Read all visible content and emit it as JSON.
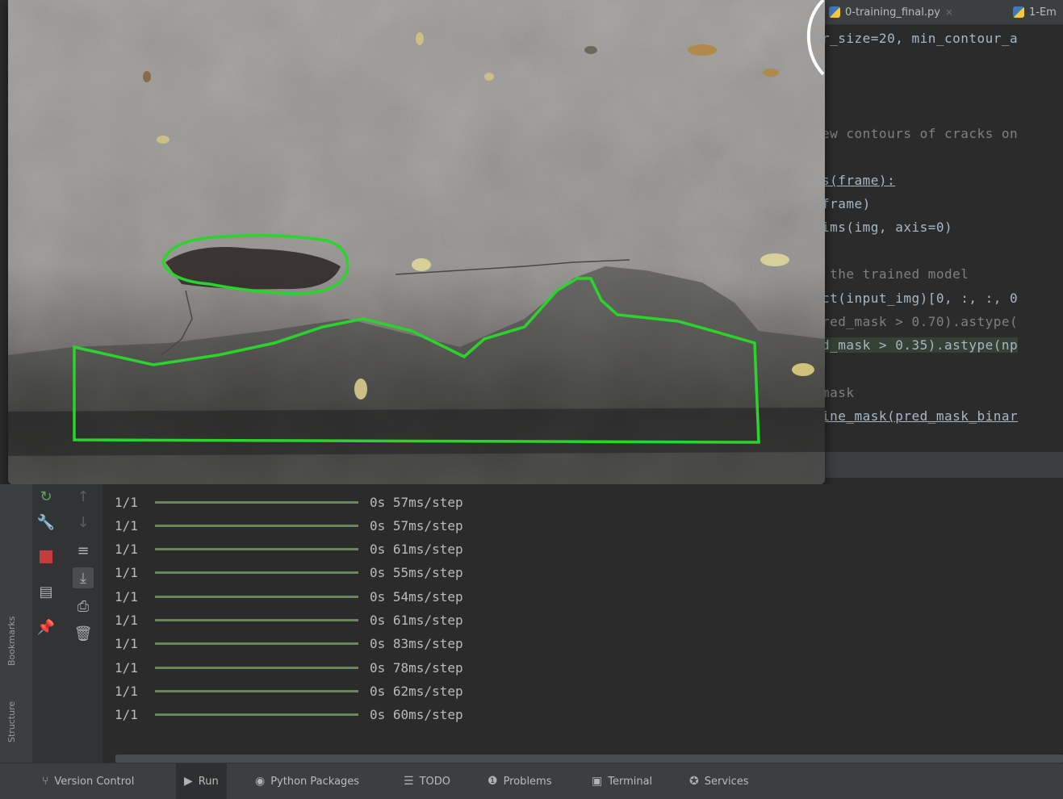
{
  "editor": {
    "tabs": [
      {
        "label": "0-training_final.py",
        "close": "×"
      },
      {
        "label": "1-Em",
        "close": ""
      }
    ],
    "code_lines": [
      {
        "text": "r_size=20, min_contour_a"
      },
      {
        "text": "ew contours of cracks on"
      },
      {
        "text": "s(frame):"
      },
      {
        "text": "frame)"
      },
      {
        "text": "ims(img, axis=0)"
      },
      {
        "text": " the trained model"
      },
      {
        "text": "ct(input_img)[0, :, :, 0"
      },
      {
        "text": "red_mask > 0.70).astype("
      },
      {
        "text": "d_mask > 0.35).astype(np"
      },
      {
        "text": "mask"
      },
      {
        "text": "ine_mask(pred_mask_binar"
      }
    ]
  },
  "image_window": {
    "description_icon": "image-viewer-window"
  },
  "run_console": {
    "lines": [
      {
        "step": "1/1",
        "time": "0s 57ms/step"
      },
      {
        "step": "1/1",
        "time": "0s 57ms/step"
      },
      {
        "step": "1/1",
        "time": "0s 61ms/step"
      },
      {
        "step": "1/1",
        "time": "0s 55ms/step"
      },
      {
        "step": "1/1",
        "time": "0s 54ms/step"
      },
      {
        "step": "1/1",
        "time": "0s 61ms/step"
      },
      {
        "step": "1/1",
        "time": "0s 83ms/step"
      },
      {
        "step": "1/1",
        "time": "0s 78ms/step"
      },
      {
        "step": "1/1",
        "time": "0s 62ms/step"
      },
      {
        "step": "1/1",
        "time": "0s 60ms/step"
      }
    ],
    "progress_fraction": 1.0
  },
  "left_rail": {
    "bookmarks_label": "Bookmarks",
    "structure_label": "Structure"
  },
  "statusbar": {
    "items": [
      {
        "label": "Version Control",
        "icon": "branch-icon"
      },
      {
        "label": "Run",
        "icon": "run-icon"
      },
      {
        "label": "Python Packages",
        "icon": "packages-icon"
      },
      {
        "label": "TODO",
        "icon": "list-icon"
      },
      {
        "label": "Problems",
        "icon": "problems-icon"
      },
      {
        "label": "Terminal",
        "icon": "terminal-icon"
      },
      {
        "label": "Services",
        "icon": "services-icon"
      }
    ]
  },
  "colors": {
    "contour": "#2bd42b",
    "progress": "#6a8759",
    "stop": "#c93b3b"
  }
}
